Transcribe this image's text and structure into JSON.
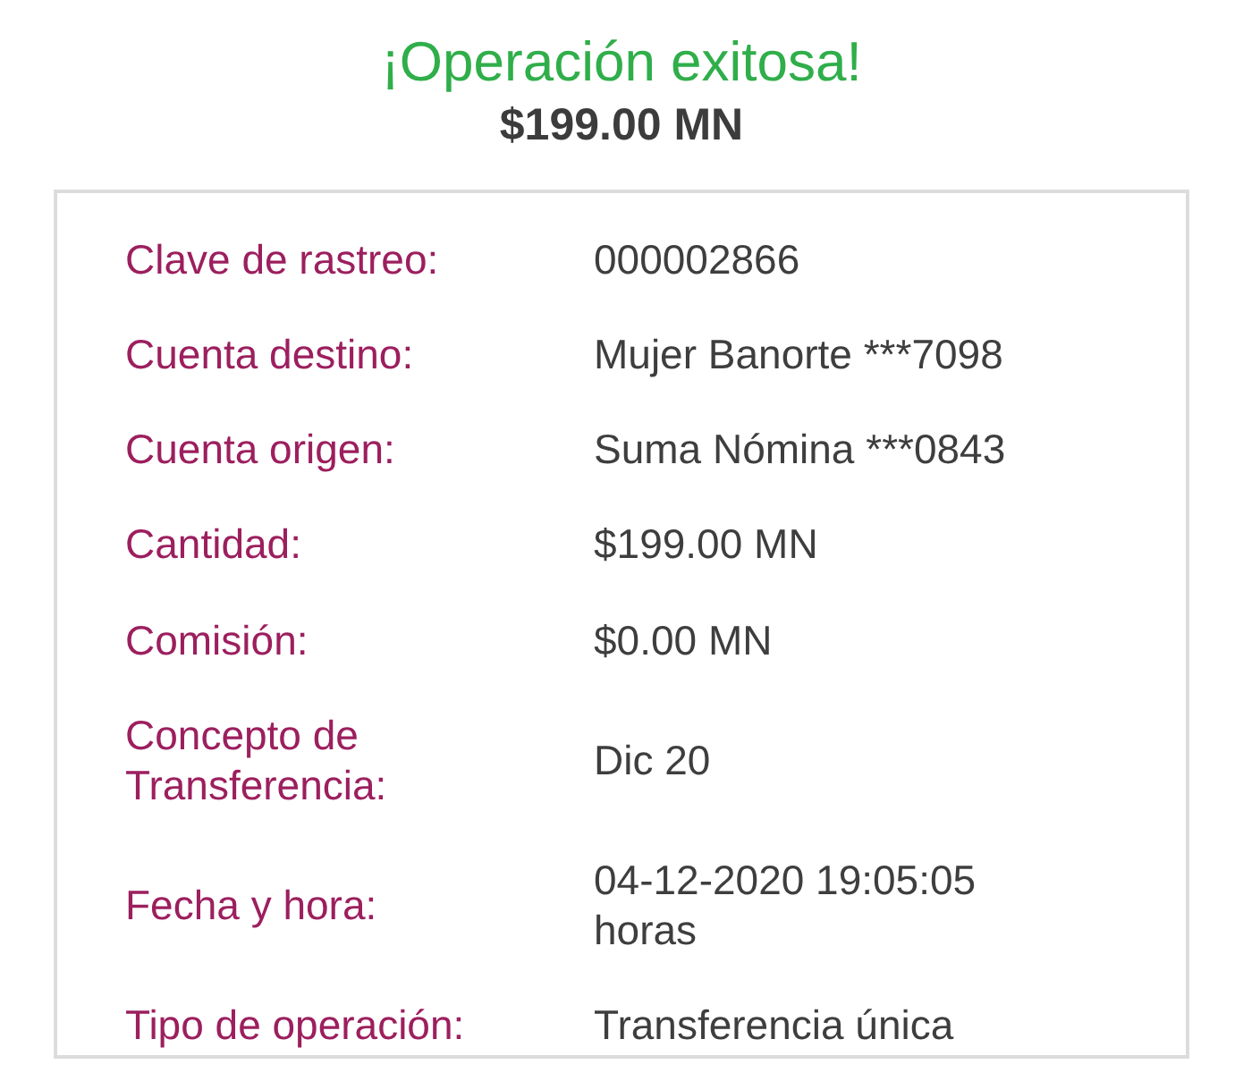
{
  "title": "¡Operación exitosa!",
  "amount": "$199.00 MN",
  "details": [
    {
      "label": "Clave de rastreo:",
      "value": "000002866"
    },
    {
      "label": "Cuenta destino:",
      "value": "Mujer Banorte ***7098"
    },
    {
      "label": "Cuenta origen:",
      "value": "Suma Nómina ***0843"
    },
    {
      "label": "Cantidad:",
      "value": "$199.00 MN"
    },
    {
      "label": "Comisión:",
      "value": "$0.00 MN"
    },
    {
      "label": "Concepto de Transferencia:",
      "value": "Dic 20"
    },
    {
      "label": "Fecha y hora:",
      "value": "04-12-2020 19:05:05 horas"
    },
    {
      "label": "Tipo de operación:",
      "value": "Transferencia única"
    }
  ]
}
